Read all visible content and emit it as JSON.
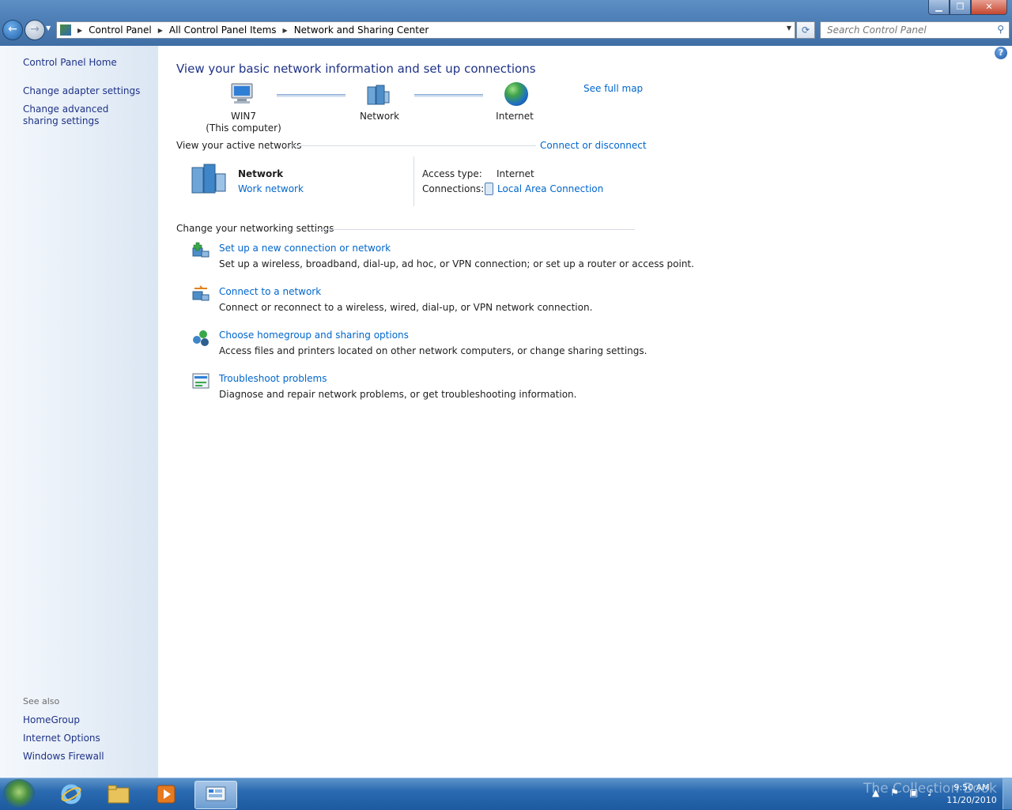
{
  "window": {
    "controls": {
      "minimize": "▁",
      "maximize": "❐",
      "close": "✕"
    }
  },
  "nav": {
    "back": "←",
    "forward": "→"
  },
  "address": {
    "breadcrumbs": [
      "Control Panel",
      "All Control Panel Items",
      "Network and Sharing Center"
    ]
  },
  "search": {
    "placeholder": "Search Control Panel"
  },
  "sidebar": {
    "home": "Control Panel Home",
    "items": [
      {
        "label": "Change adapter settings"
      },
      {
        "label": "Change advanced sharing settings"
      }
    ],
    "see_also": {
      "heading": "See also",
      "items": [
        {
          "label": "HomeGroup"
        },
        {
          "label": "Internet Options"
        },
        {
          "label": "Windows Firewall"
        }
      ]
    }
  },
  "main": {
    "title": "View your basic network information and set up connections",
    "see_full_map": "See full map",
    "map": {
      "computer": {
        "name": "WIN7",
        "sub": "(This computer)"
      },
      "network": {
        "name": "Network"
      },
      "internet": {
        "name": "Internet"
      }
    },
    "active_networks": {
      "heading": "View your active networks",
      "connect_link": "Connect or disconnect",
      "network_name": "Network",
      "network_type": "Work network",
      "access_type_label": "Access type:",
      "access_type_value": "Internet",
      "connections_label": "Connections:",
      "connections_value": "Local Area Connection"
    },
    "settings": {
      "heading": "Change your networking settings",
      "tasks": [
        {
          "title": "Set up a new connection or network",
          "desc": "Set up a wireless, broadband, dial-up, ad hoc, or VPN connection; or set up a router or access point.",
          "icon": "network-setup-icon"
        },
        {
          "title": "Connect to a network",
          "desc": "Connect or reconnect to a wireless, wired, dial-up, or VPN network connection.",
          "icon": "connect-network-icon"
        },
        {
          "title": "Choose homegroup and sharing options",
          "desc": "Access files and printers located on other network computers, or change sharing settings.",
          "icon": "homegroup-icon"
        },
        {
          "title": "Troubleshoot problems",
          "desc": "Diagnose and repair network problems, or get troubleshooting information.",
          "icon": "troubleshoot-icon"
        }
      ]
    }
  },
  "taskbar": {
    "clock_time": "9:50 AM",
    "clock_date": "11/20/2010",
    "watermark": "The Collection Book"
  },
  "colors": {
    "link": "#0066cc",
    "heading": "#1e3287",
    "taskbar": "#2a6ab0"
  }
}
